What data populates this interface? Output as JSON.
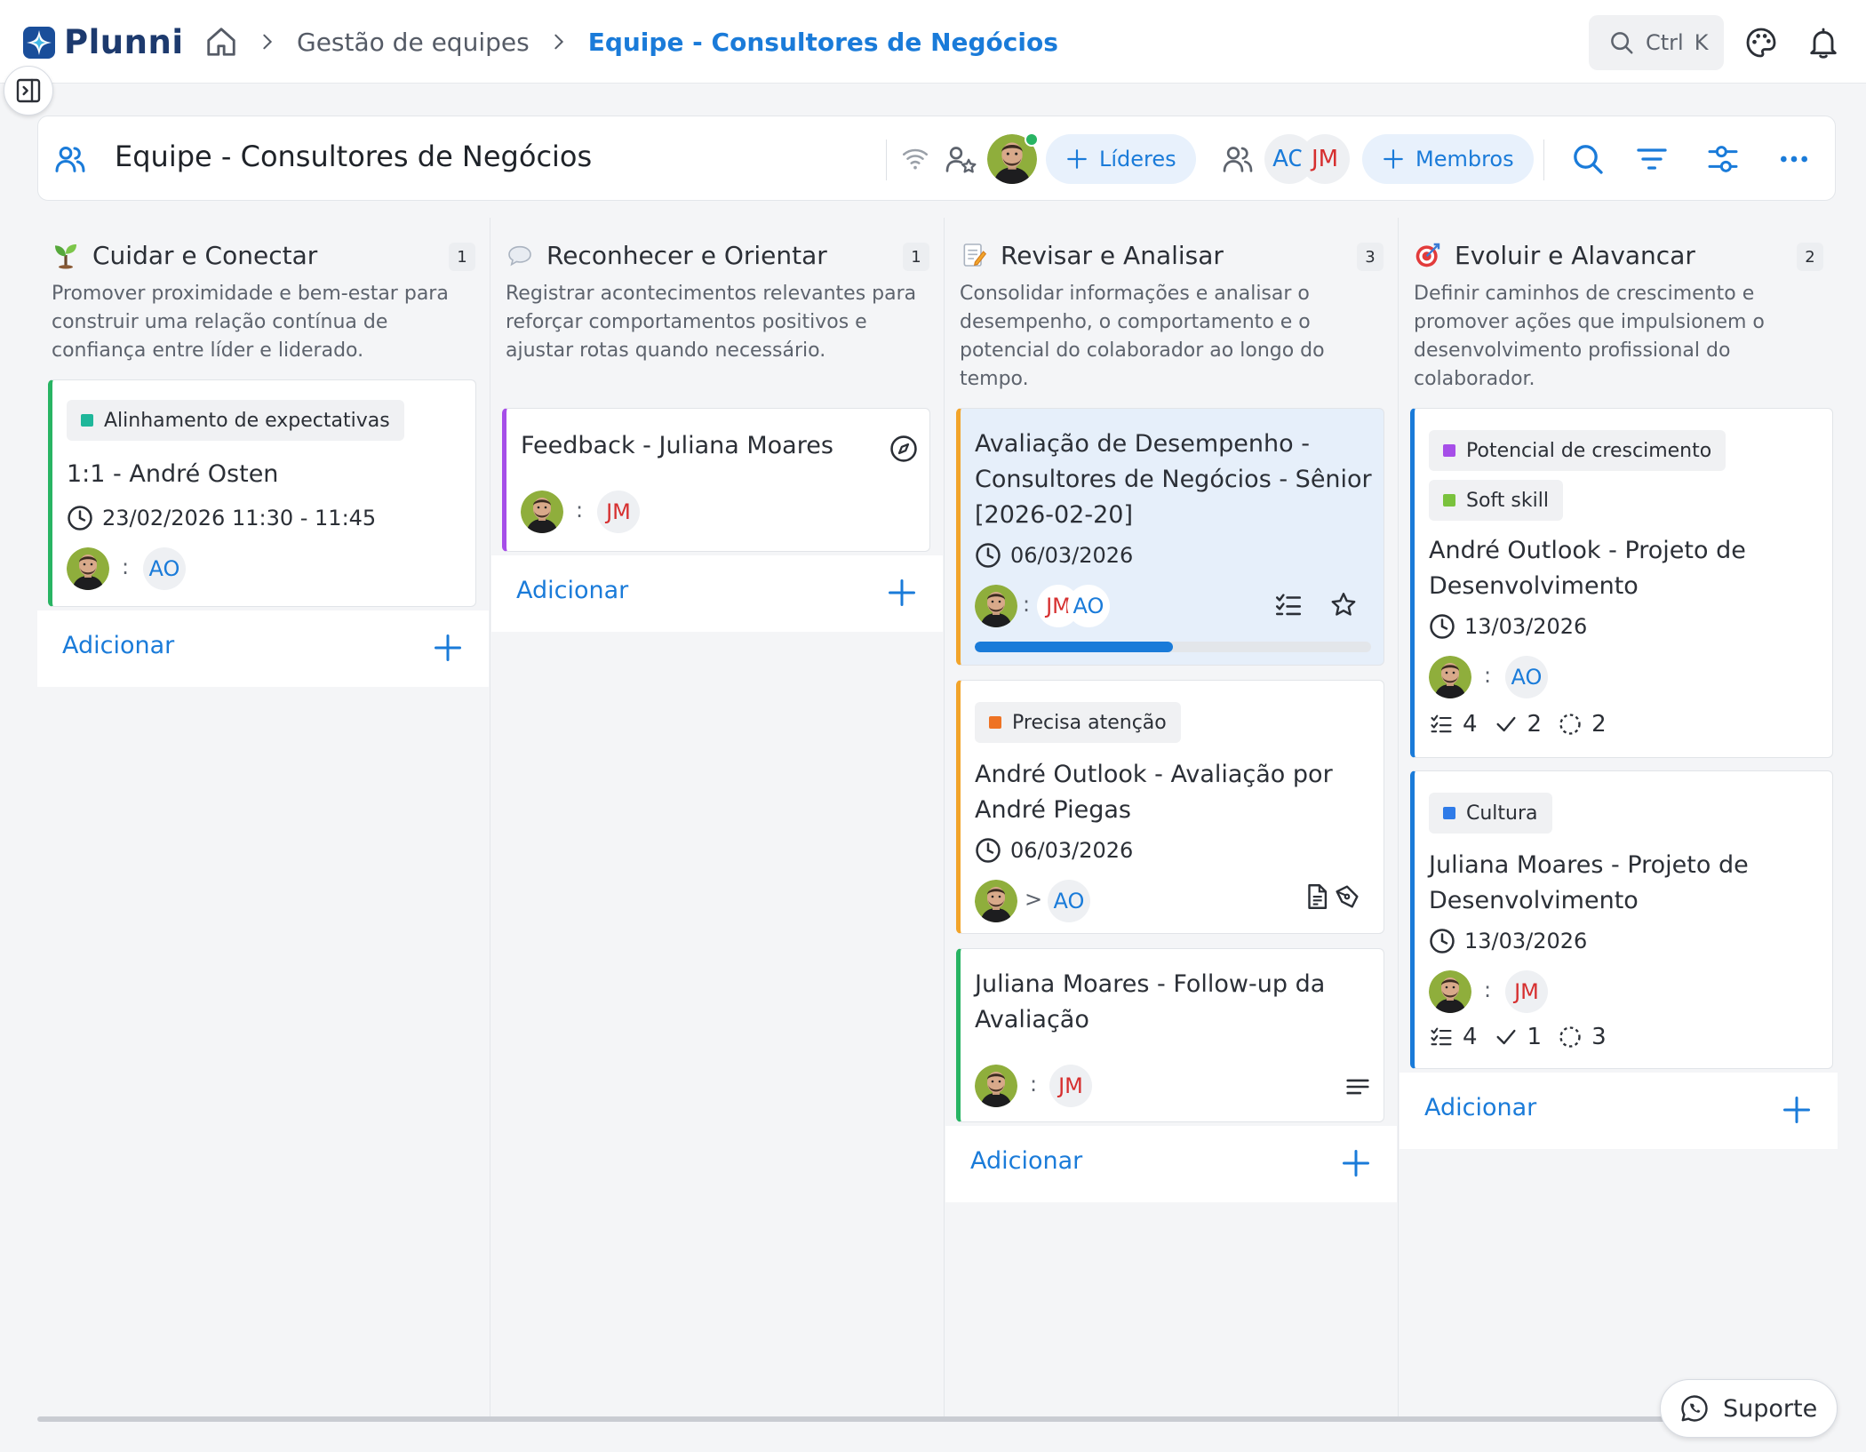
{
  "app": {
    "name": "Plunni"
  },
  "breadcrumb": {
    "section": "Gestão de equipes",
    "current": "Equipe - Consultores de Negócios"
  },
  "search": {
    "shortcut_ctrl": "Ctrl",
    "shortcut_key": "K"
  },
  "team": {
    "title": "Equipe - Consultores de Negócios",
    "leaders_button": "Líderes",
    "members_button": "Membros",
    "member_initials": [
      "AO",
      "JM"
    ]
  },
  "colors": {
    "accent": "#1a7bd9",
    "green": "#28b463",
    "purple": "#a64ee8",
    "orange": "#f2a42a",
    "blue": "#1a7bd9"
  },
  "columns": [
    {
      "title": "Cuidar e Conectar",
      "count": "1",
      "emoji": "seedling-icon",
      "description": "Promover proximidade e bem-estar para construir uma relação contínua de confiança entre líder e liderado.",
      "add_label": "Adicionar",
      "cards": [
        {
          "tag": "Alinhamento de expectativas",
          "title": "1:1 - André Osten",
          "date": "23/02/2026 11:30 - 11:45",
          "separator": ":",
          "assignees": [
            "AO"
          ]
        }
      ]
    },
    {
      "title": "Reconhecer e Orientar",
      "count": "1",
      "emoji": "speech-bubble-icon",
      "description": "Registrar acontecimentos relevantes para reforçar comportamentos positivos e ajustar rotas quando necessário.",
      "add_label": "Adicionar",
      "cards": [
        {
          "title": "Feedback - Juliana Moares",
          "separator": ":",
          "assignees": [
            "JM"
          ]
        }
      ]
    },
    {
      "title": "Revisar e Analisar",
      "count": "3",
      "emoji": "memo-icon",
      "description": "Consolidar informações e analisar o desempenho, o comportamento e o potencial do colaborador ao longo do tempo.",
      "add_label": "Adicionar",
      "cards": [
        {
          "title": "Avaliação de Desempenho - Consultores de Negócios - Sênior [2026-02-20]",
          "date": "06/03/2026",
          "separator": ":",
          "assignees": [
            "JM",
            "AO"
          ],
          "progress": 0.5
        },
        {
          "tag": "Precisa atenção",
          "title": "André Outlook - Avaliação por André Piegas",
          "date": "06/03/2026",
          "separator": ">",
          "assignees": [
            "AO"
          ]
        },
        {
          "title": "Juliana Moares - Follow-up da Avaliação",
          "separator": ":",
          "assignees": [
            "JM"
          ]
        }
      ]
    },
    {
      "title": "Evoluir e Alavancar",
      "count": "2",
      "emoji": "target-icon",
      "description": "Definir caminhos de crescimento e promover ações que impulsionem o desenvolvimento profissional do colaborador.",
      "add_label": "Adicionar",
      "cards": [
        {
          "tags": [
            "Potencial de crescimento",
            "Soft skill"
          ],
          "title": "André Outlook - Projeto de Desenvolvimento",
          "date": "13/03/2026",
          "separator": ":",
          "assignees": [
            "AO"
          ],
          "tasks_total": "4",
          "tasks_done": "2",
          "tasks_pending": "2"
        },
        {
          "tag": "Cultura",
          "title": "Juliana Moares - Projeto de Desenvolvimento",
          "date": "13/03/2026",
          "separator": ":",
          "assignees": [
            "JM"
          ],
          "tasks_total": "4",
          "tasks_done": "1",
          "tasks_pending": "3"
        }
      ]
    }
  ],
  "support": {
    "label": "Suporte"
  }
}
